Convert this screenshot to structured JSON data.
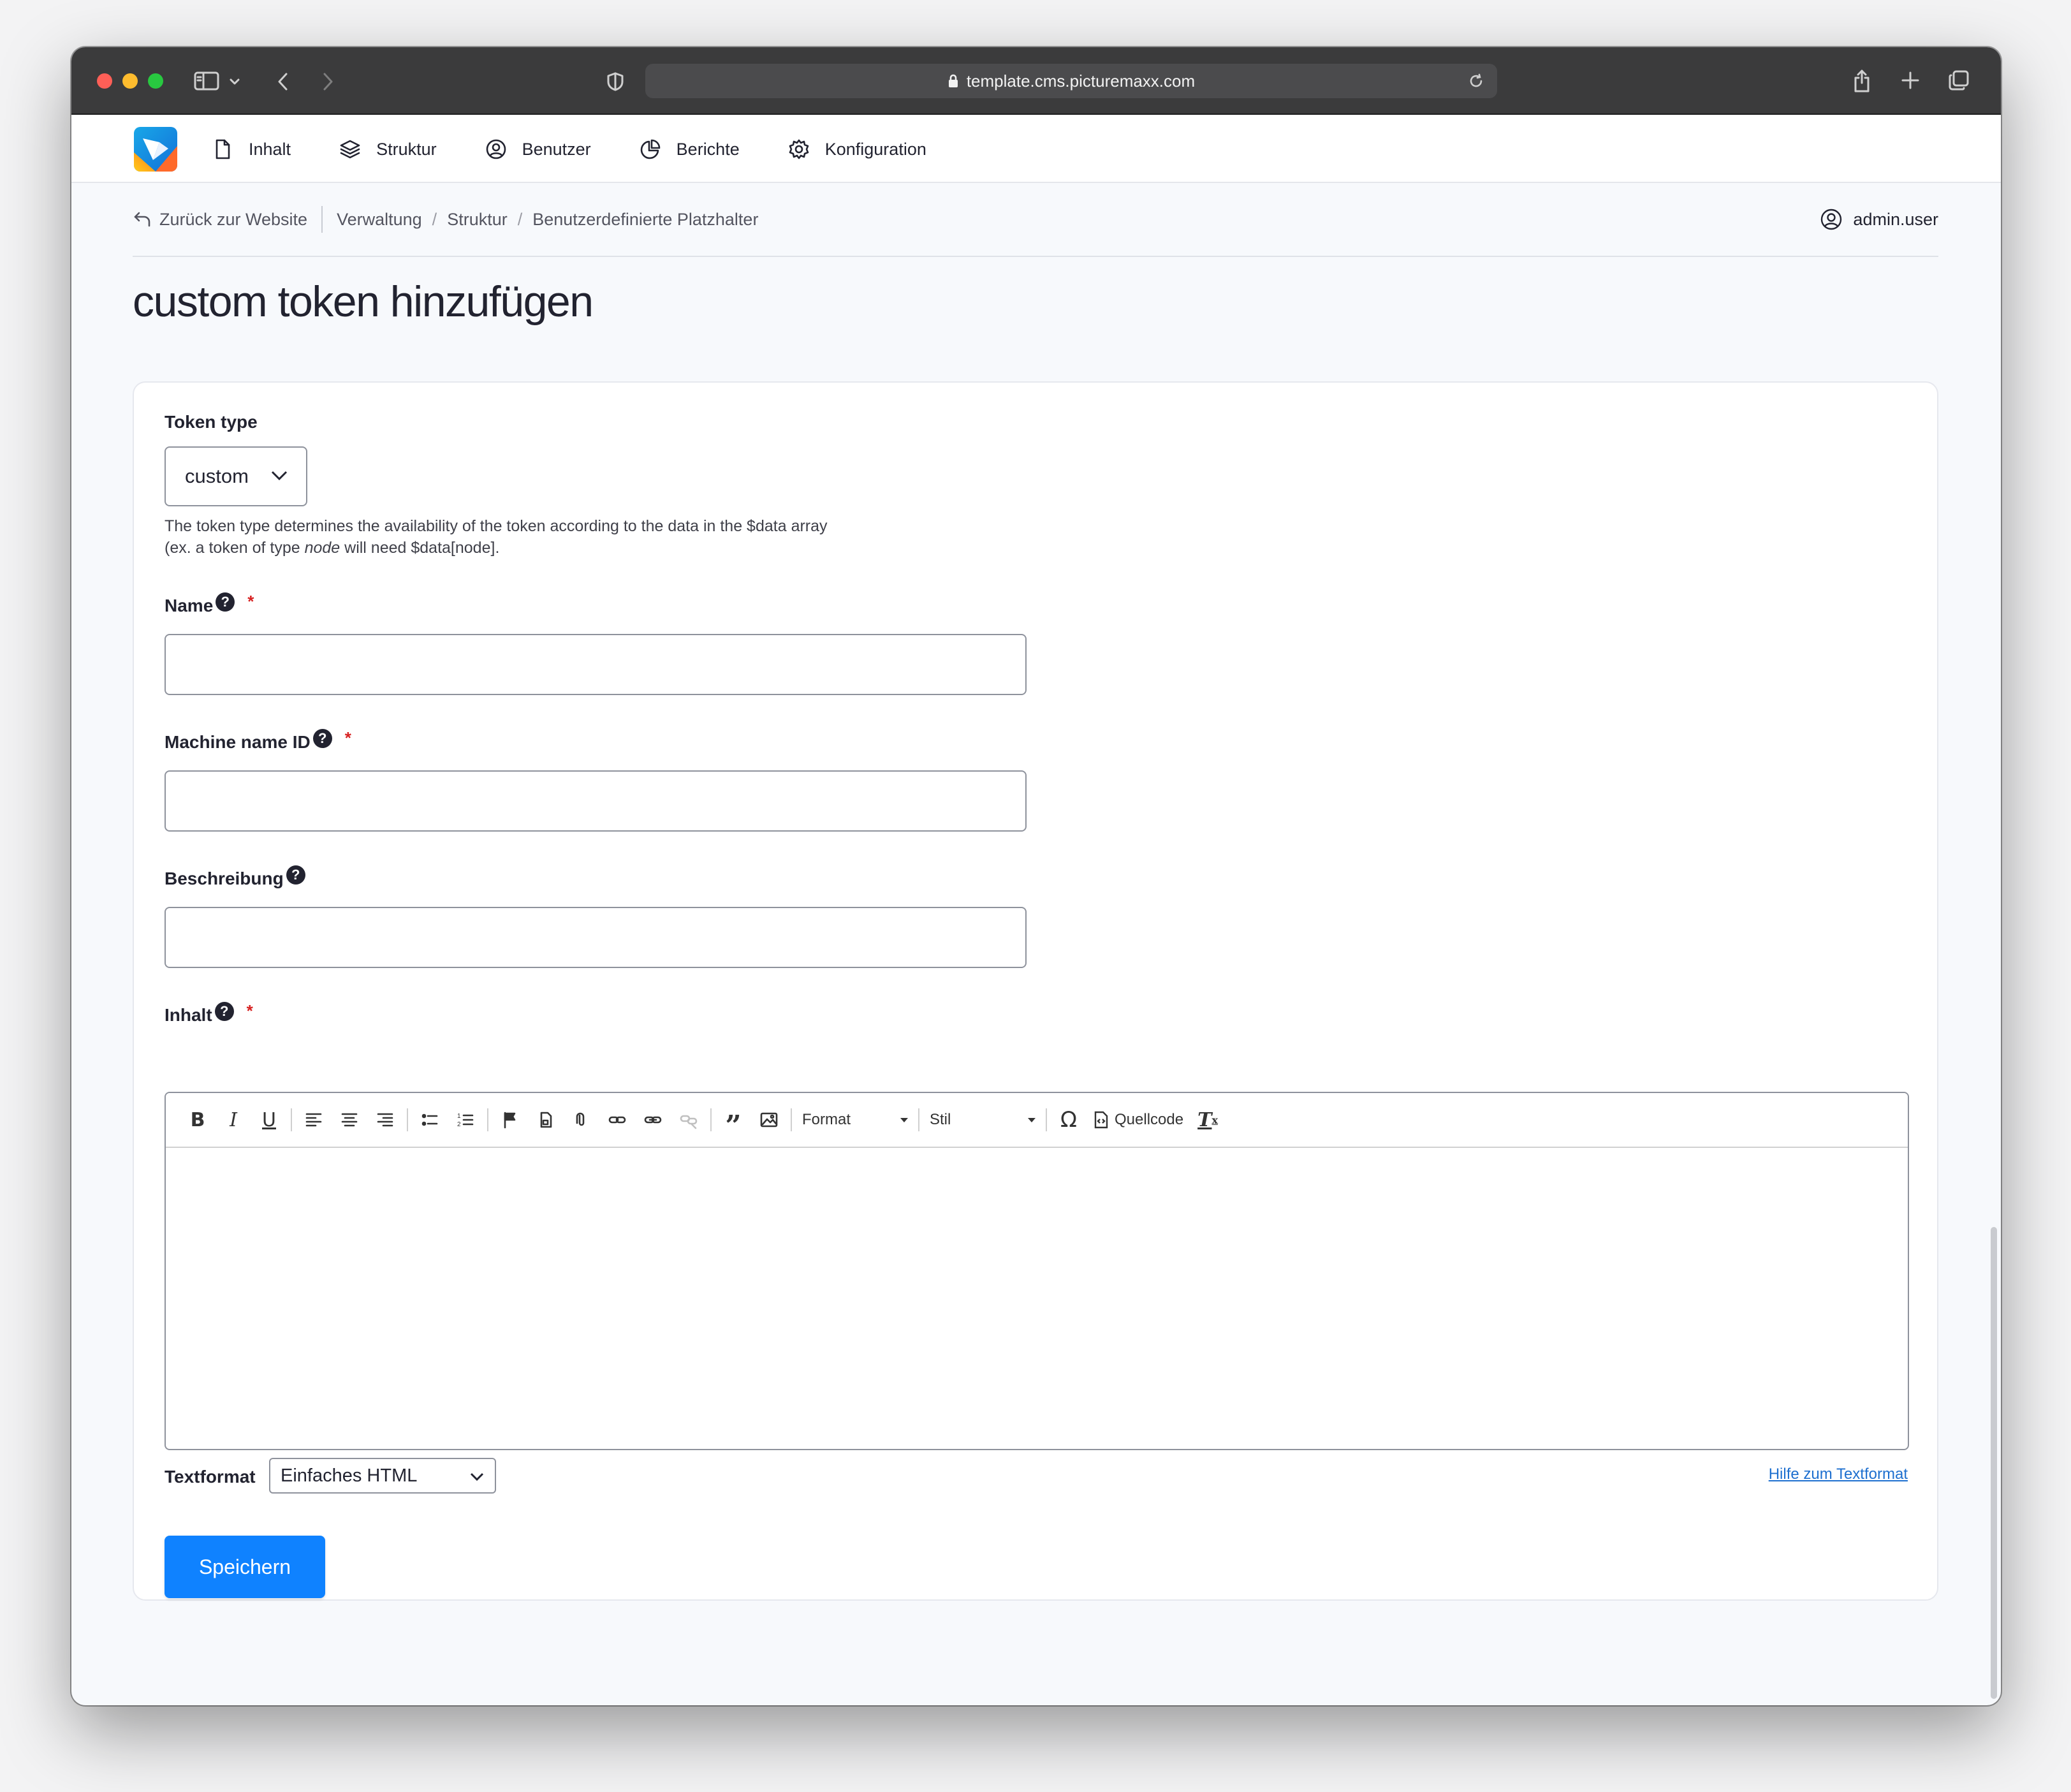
{
  "browser": {
    "url": "template.cms.picturemaxx.com"
  },
  "adminbar": {
    "items": [
      {
        "label": "Inhalt",
        "icon": "document-icon"
      },
      {
        "label": "Struktur",
        "icon": "layers-icon"
      },
      {
        "label": "Benutzer",
        "icon": "user-circle-icon"
      },
      {
        "label": "Berichte",
        "icon": "pie-chart-icon"
      },
      {
        "label": "Konfiguration",
        "icon": "gear-icon"
      }
    ]
  },
  "breadcrumb": {
    "back_label": "Zurück zur Website",
    "items": [
      "Verwaltung",
      "Struktur",
      "Benutzerdefinierte Platzhalter"
    ],
    "separator": "/",
    "user": "admin.user"
  },
  "page": {
    "title": "custom token hinzufügen"
  },
  "form": {
    "token_type": {
      "label": "Token type",
      "value": "custom",
      "description_part1": "The token type determines the availability of the token according to the data in the $data array (ex. a token of type ",
      "description_em": "node",
      "description_part2": " will need $data[node]."
    },
    "name": {
      "label": "Name",
      "value": "",
      "required_mark": "*"
    },
    "machine_name": {
      "label": "Machine name ID",
      "value": "",
      "required_mark": "*"
    },
    "description": {
      "label": "Beschreibung",
      "value": ""
    },
    "content": {
      "label": "Inhalt",
      "required_mark": "*",
      "toolbar": {
        "format_label": "Format",
        "style_label": "Stil",
        "source_label": "Quellcode"
      }
    },
    "textformat": {
      "label": "Textformat",
      "value": "Einfaches HTML",
      "help_link": "Hilfe zum Textformat"
    },
    "save_label": "Speichern"
  },
  "colors": {
    "primary_button": "#0f82ff",
    "required": "#d72222",
    "link": "#1d6fcf"
  }
}
